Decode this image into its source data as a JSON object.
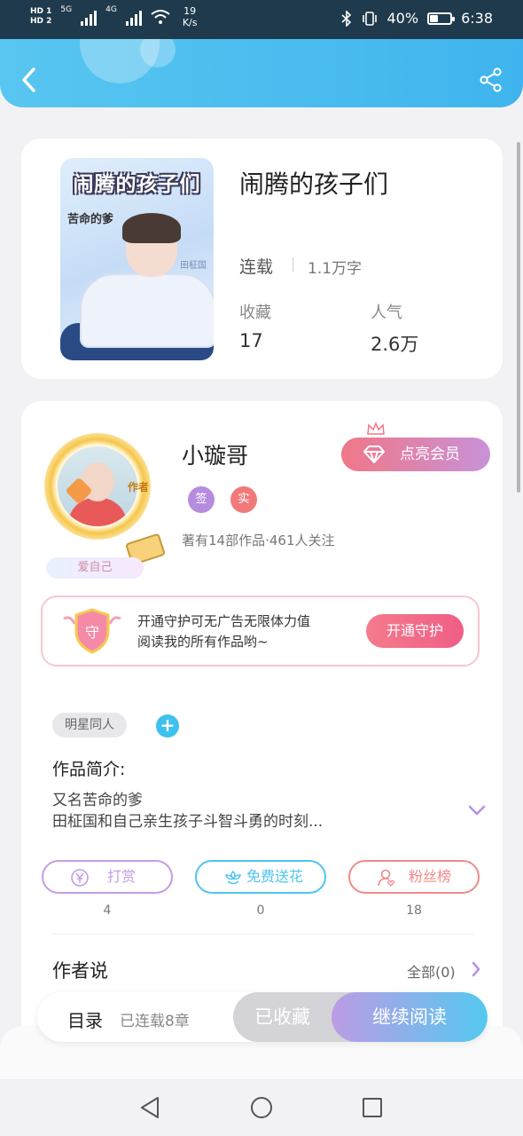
{
  "status_bar": {
    "hd1": "HD 1",
    "hd2": "HD 2",
    "net1": "5G",
    "net2": "4G",
    "speed_value": "19",
    "speed_unit": "K/s",
    "battery_percent": "40%",
    "battery_level": 0.4,
    "time": "6:38"
  },
  "book": {
    "title": "闹腾的孩子们",
    "cover_title": "闹腾的孩子们",
    "cover_author": "苦命的爹",
    "cover_watermark": "田柾国",
    "status": "连载",
    "word_count": "1.1万字",
    "favorites_label": "收藏",
    "favorites_value": "17",
    "popularity_label": "人气",
    "popularity_value": "2.6万"
  },
  "author": {
    "name": "小璇哥",
    "avatar_tag": "作者",
    "pill": "爱自己",
    "badge_signed": "签",
    "badge_verified": "实",
    "stats": "著有14部作品·461人关注",
    "vip_button": "点亮会员"
  },
  "guard": {
    "shield_char": "守",
    "text_line1": "开通守护可无广告无限体力值",
    "text_line2": "阅读我的所有作品哟~",
    "button": "开通守护"
  },
  "tags": {
    "tag1": "明星同人",
    "add": "+"
  },
  "intro": {
    "title": "作品简介:",
    "line1": "又名苦命的爹",
    "line2": "田柾国和自己亲生孩子斗智斗勇的时刻..."
  },
  "actions": [
    {
      "label": "打赏",
      "count": "4",
      "color": "#c39de6"
    },
    {
      "label": "免费送花",
      "count": "0",
      "color": "#4ec5ee"
    },
    {
      "label": "粉丝榜",
      "count": "18",
      "color": "#f08a8a"
    }
  ],
  "sayings": {
    "title": "作者说",
    "all": "全部(0)"
  },
  "bottom": {
    "toc": "目录",
    "chapters": "已连载8章",
    "favorited": "已收藏",
    "continue": "继续阅读"
  },
  "colors": {
    "header": "#3fb4ee",
    "accent_pink": "#f07787",
    "accent_purple": "#c39de6",
    "accent_blue": "#4ec5ee"
  }
}
